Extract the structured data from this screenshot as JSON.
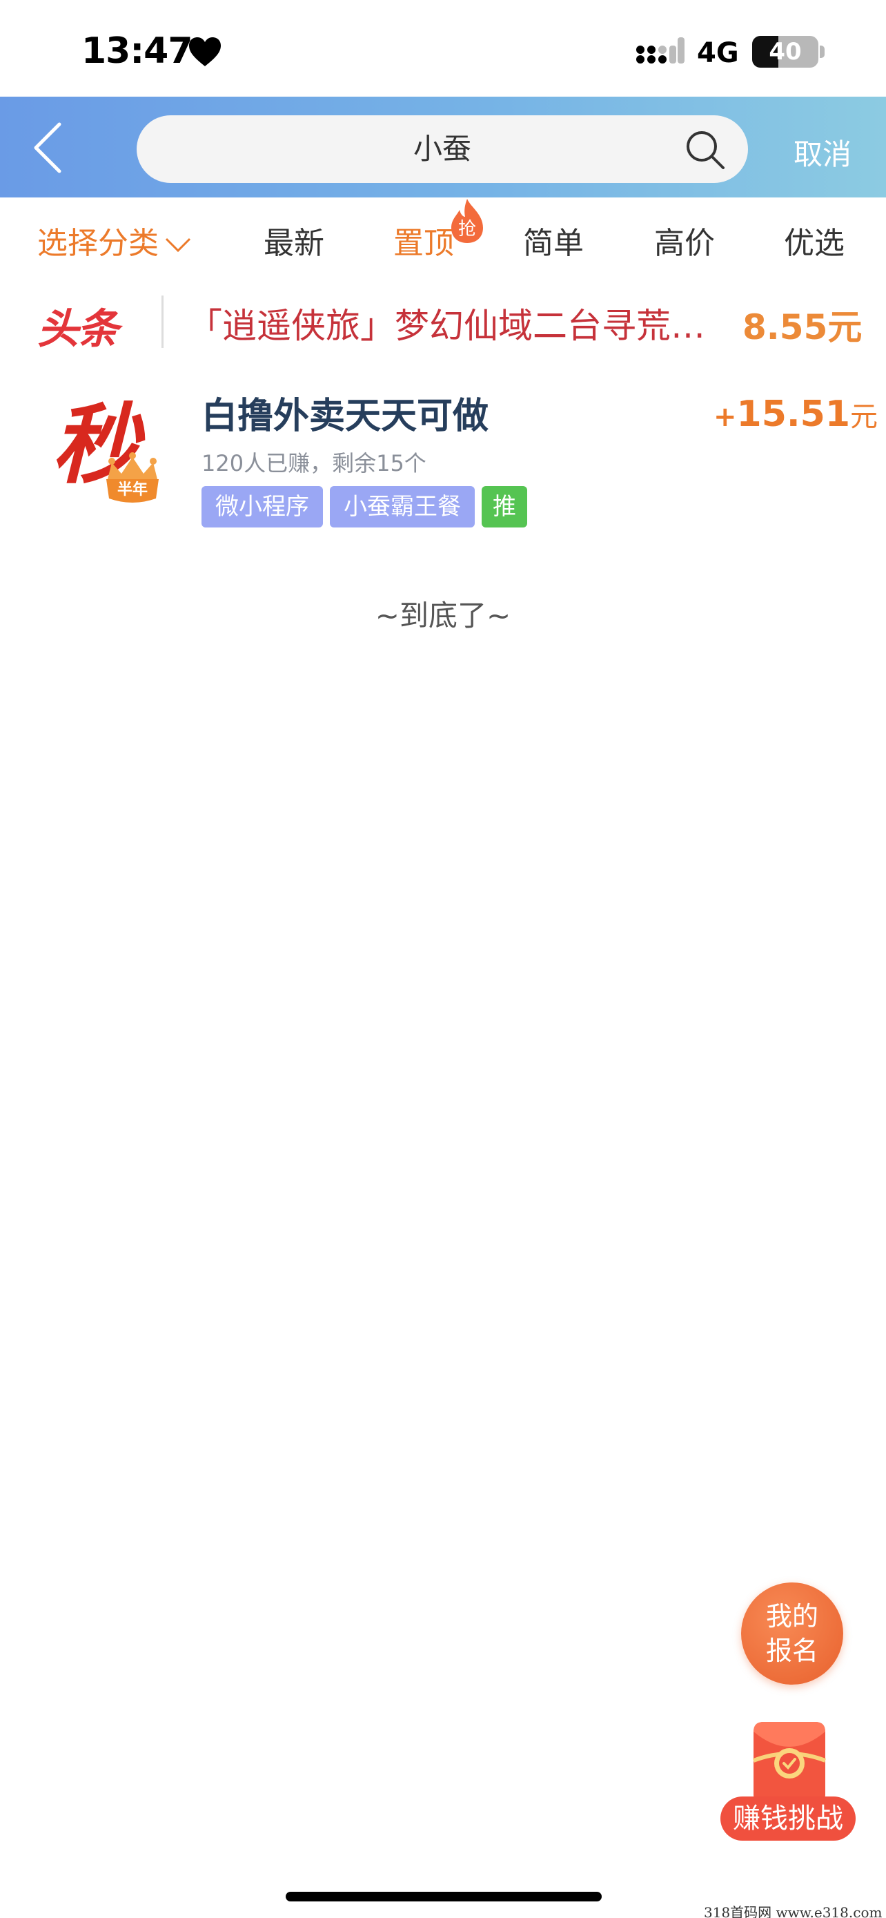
{
  "status_bar": {
    "time": "13:47",
    "network": "4G",
    "battery": "40",
    "battery_level": 0.4
  },
  "header": {
    "search_value": "小蚕",
    "cancel_label": "取消"
  },
  "filters": {
    "items": [
      "选择分类",
      "最新",
      "置顶",
      "简单",
      "高价",
      "优选"
    ],
    "hot_badge": "抢"
  },
  "headline": {
    "badge": "头条",
    "text": "「逍遥侠旅」梦幻仙域二台寻荒…",
    "price": "8.55元"
  },
  "task": {
    "thumb_text": "秒",
    "thumb_badge": "半年",
    "title": "白撸外卖天天可做",
    "price_sign": "+",
    "price_value": "15.51",
    "price_unit": "元",
    "sub": "120人已赚，剩余15个",
    "tags": [
      "微小程序",
      "小蚕霸王餐",
      "推"
    ]
  },
  "end_text": "~到底了~",
  "floating": {
    "signup_label": "我的报名",
    "challenge_label": "赚钱挑战"
  },
  "watermark": "318首码网  www.e318.com",
  "colors": {
    "accent_orange": "#ec7a2a",
    "header_gradient_start": "#6a9be6",
    "headline_red": "#c6323a",
    "tag_purple": "#9aa7f4",
    "tag_green": "#55c452"
  }
}
